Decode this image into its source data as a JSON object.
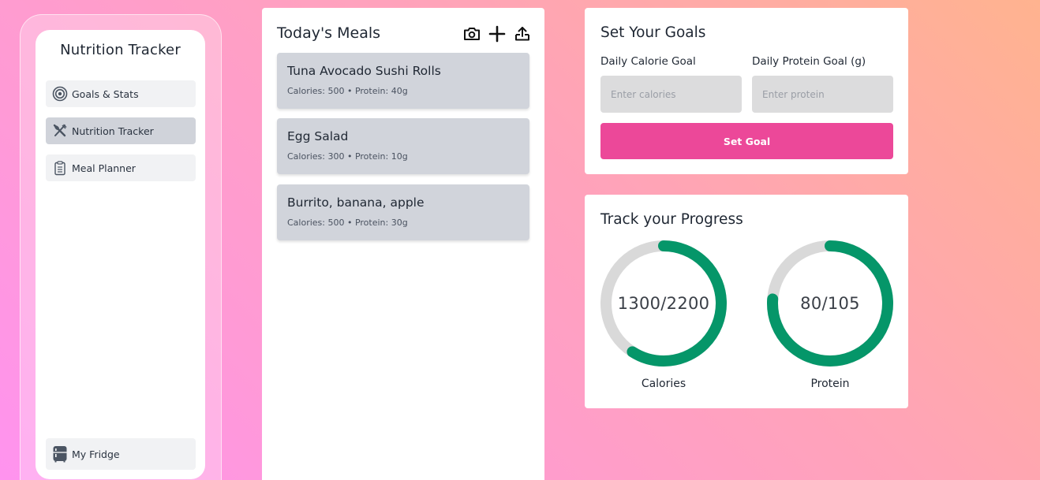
{
  "sidebar": {
    "title": "Nutrition Tracker",
    "items": [
      {
        "label": "Goals & Stats",
        "icon": "target-icon",
        "active": false
      },
      {
        "label": "Nutrition Tracker",
        "icon": "utensils-icon",
        "active": true
      },
      {
        "label": "Meal Planner",
        "icon": "clipboard-icon",
        "active": false
      }
    ],
    "fridge": {
      "label": "My Fridge",
      "icon": "fridge-icon"
    }
  },
  "meals": {
    "title": "Today's Meals",
    "actions": [
      {
        "icon": "camera-icon"
      },
      {
        "icon": "plus-icon"
      },
      {
        "icon": "upload-icon"
      }
    ],
    "items": [
      {
        "name": "Tuna Avocado Sushi Rolls",
        "meta": "Calories: 500 • Protein: 40g"
      },
      {
        "name": "Egg Salad",
        "meta": "Calories: 300 • Protein: 10g"
      },
      {
        "name": "Burrito, banana, apple",
        "meta": "Calories: 500 • Protein: 30g"
      }
    ]
  },
  "goals": {
    "title": "Set Your Goals",
    "calorie_label": "Daily Calorie Goal",
    "calorie_placeholder": "Enter calories",
    "protein_label": "Daily Protein Goal (g)",
    "protein_placeholder": "Enter protein",
    "button_label": "Set Goal",
    "button_color": "#ec4899"
  },
  "progress": {
    "title": "Track your Progress",
    "ring_color": "#059669",
    "track_color": "#d9d9d9",
    "rings": [
      {
        "label": "Calories",
        "text": "1300/2200",
        "current": 1300,
        "goal": 2200
      },
      {
        "label": "Protein",
        "text": "80/105",
        "current": 80,
        "goal": 105
      }
    ]
  }
}
